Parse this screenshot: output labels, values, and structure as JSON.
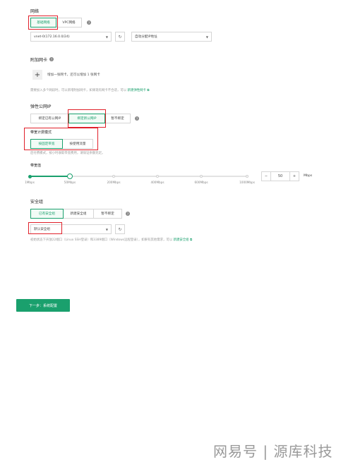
{
  "network": {
    "title": "网络",
    "tabs": [
      "基础网络",
      "VPC网络"
    ],
    "vnet_select": "vnet-0(172.16.0.0/24)",
    "ip_select": "自动分配IP地址"
  },
  "nic": {
    "title": "附加网卡",
    "add_label": "增加一张网卡，还可以增加 1 张网卡",
    "hint": "需要加入多个网段时，可以新增附加网卡，如果现有网卡不合适，可以",
    "hint_link": "新建弹性网卡"
  },
  "eip": {
    "title": "弹性公网IP",
    "tabs": [
      "绑定已有公网IP",
      "绑定新公网IP",
      "暂不绑定"
    ]
  },
  "billing": {
    "title": "带宽计费模式",
    "tabs": [
      "按固定带宽",
      "按使用流量"
    ],
    "hint": "后付费模式，按小时收取带宽费用，请保证余额充足。"
  },
  "bandwidth": {
    "title": "带宽值",
    "value": 50,
    "max": 1000,
    "ticks": [
      "1Mbps",
      "50Mbps",
      "200Mbps",
      "400Mbps",
      "600Mbps",
      "1000Mbps"
    ],
    "minus": "−",
    "plus": "+",
    "input": "50",
    "unit": "Mbps"
  },
  "security": {
    "title": "安全组",
    "tabs": [
      "已有安全组",
      "新建安全组",
      "暂不绑定"
    ],
    "select": "默认安全组",
    "hint": "初始状态下开放22端口（Linux SSH登录）和3389端口（Windows远程登录），如果有其他需求，可以",
    "hint_link": "新建安全组"
  },
  "footer": {
    "next_button": "下一步：系统配置"
  },
  "watermark": "网易号 | 源库科技",
  "colors": {
    "accent": "#1aa06d",
    "highlight": "#e0202a"
  },
  "icons": {
    "help": "help-icon",
    "refresh": "refresh-icon",
    "caret": "chevron-down-icon",
    "external": "external-link-icon",
    "plus": "plus-icon"
  }
}
